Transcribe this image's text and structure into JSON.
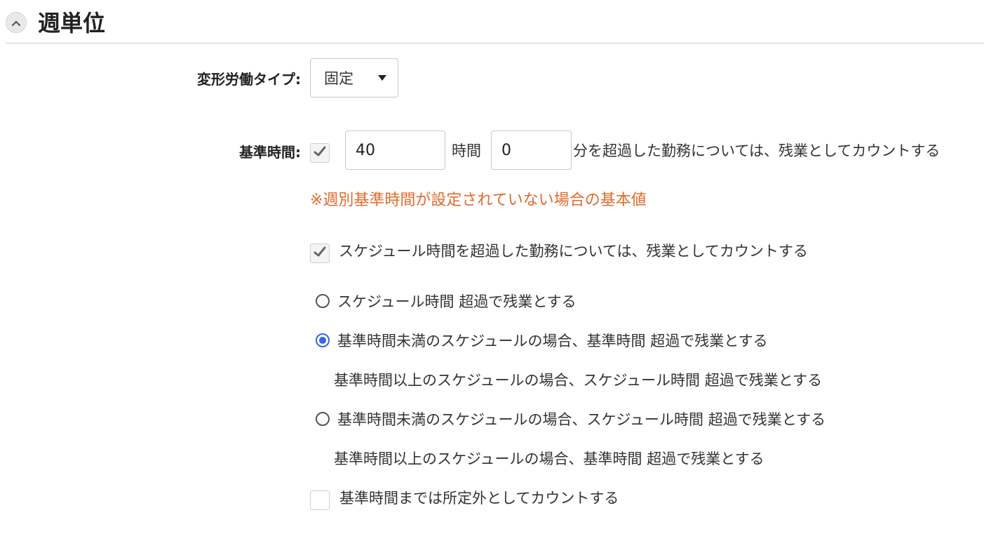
{
  "section": {
    "title": "週単位",
    "collapse_icon": "chevron-up-icon"
  },
  "variable_work_type": {
    "label": "変形労働タイプ:",
    "selected": "固定",
    "arrow_icon": "caret-down-icon"
  },
  "base_time": {
    "label": "基準時間:",
    "checked": true,
    "hours_value": "40",
    "hours_unit": "時間",
    "minutes_value": "0",
    "suffix": "分を超過した勤務については、残業としてカウントする",
    "note": "※週別基準時間が設定されていない場合の基本値",
    "note_color": "#e06b2c"
  },
  "schedule_overtime": {
    "checked": true,
    "label": "スケジュール時間を超過した勤務については、残業としてカウントする"
  },
  "overtime_options": [
    {
      "selected": false,
      "line1": "スケジュール時間 超過で残業とする",
      "line2": ""
    },
    {
      "selected": true,
      "line1": "基準時間未満のスケジュールの場合、基準時間 超過で残業とする",
      "line2": "基準時間以上のスケジュールの場合、スケジュール時間 超過で残業とする"
    },
    {
      "selected": false,
      "line1": "基準時間未満のスケジュールの場合、スケジュール時間 超過で残業とする",
      "line2": "基準時間以上のスケジュールの場合、基準時間 超過で残業とする"
    }
  ],
  "count_as_non_scheduled": {
    "checked": false,
    "label": "基準時間までは所定外としてカウントする"
  },
  "colors": {
    "accent": "#3b63e6",
    "note": "#e06b2c"
  }
}
